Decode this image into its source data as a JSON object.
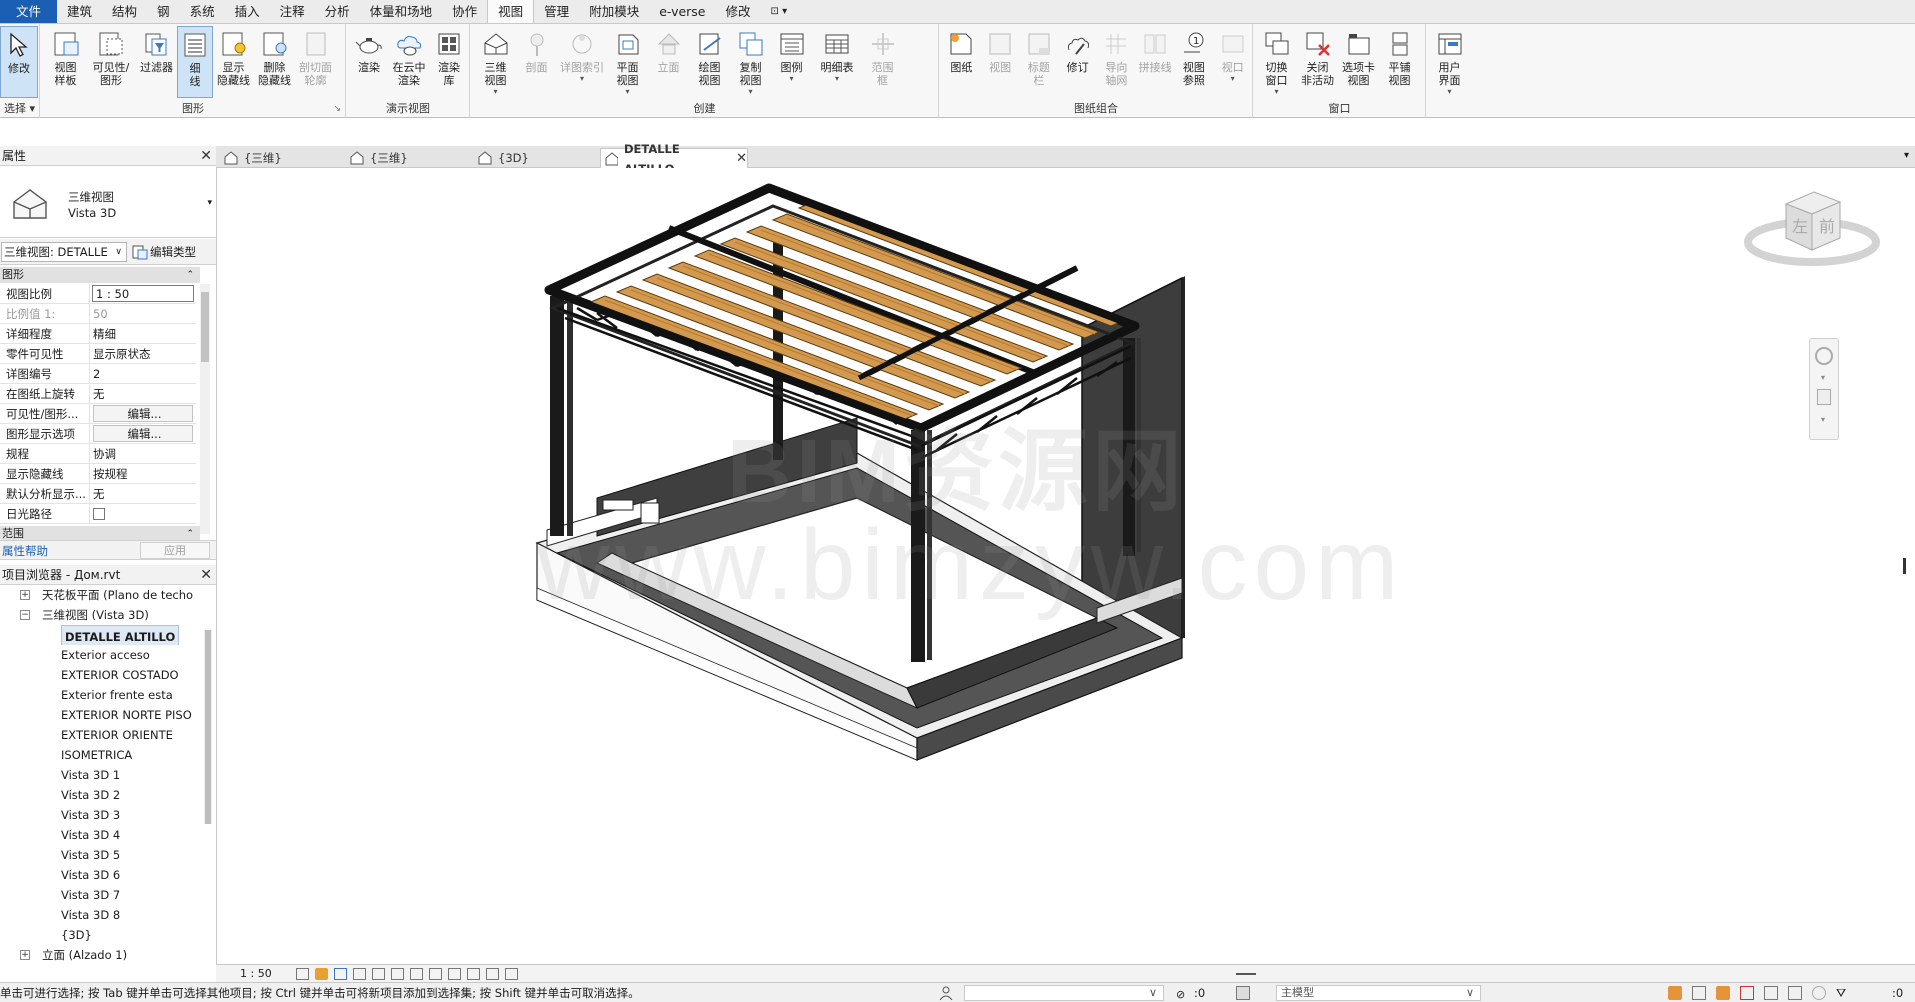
{
  "menu": {
    "tabs": [
      "文件",
      "建筑",
      "结构",
      "钢",
      "系统",
      "插入",
      "注释",
      "分析",
      "体量和场地",
      "协作",
      "视图",
      "管理",
      "附加模块",
      "e-verse",
      "修改",
      "⊡ ▾"
    ],
    "active_tab": "视图"
  },
  "ribbon": {
    "select": {
      "button": "修改",
      "panel": "选择"
    },
    "graphics": {
      "panel": "图形",
      "buttons": [
        "视图\n样板",
        "可见性/\n图形",
        "过滤器",
        "细\n线",
        "显示\n隐藏线",
        "删除\n隐藏线",
        "剖切面\n轮廓"
      ]
    },
    "presentation": {
      "panel": "演示视图",
      "buttons": [
        "渲染",
        "在云中\n渲染",
        "渲染\n库"
      ]
    },
    "create": {
      "panel": "创建",
      "buttons": [
        "三维\n视图",
        "剖面",
        "详图索引",
        "平面\n视图",
        "立面",
        "绘图\n视图",
        "复制\n视图",
        "图例",
        "明细表",
        "范围\n框"
      ]
    },
    "sheet": {
      "panel": "图纸组合",
      "buttons": [
        "图纸",
        "视图",
        "标题\n栏",
        "修订",
        "导向\n轴网",
        "拼接线",
        "视图\n参照",
        "视口"
      ]
    },
    "windows": {
      "panel": "窗口",
      "buttons": [
        "切换\n窗口",
        "关闭\n非活动",
        "选项卡\n视图",
        "平铺\n视图"
      ]
    },
    "ui": {
      "button": "用户\n界面"
    }
  },
  "properties": {
    "title": "属性",
    "type_line1": "三维视图",
    "type_line2": "Vista 3D",
    "filter": "三维视图: DETALLE",
    "edit_type": "编辑类型",
    "section_graphics": "图形",
    "rows": [
      {
        "key": "视图比例",
        "value": "1 : 50"
      },
      {
        "key": "比例值 1:",
        "value": "50"
      },
      {
        "key": "详细程度",
        "value": "精细"
      },
      {
        "key": "零件可见性",
        "value": "显示原状态"
      },
      {
        "key": "详图编号",
        "value": "2"
      },
      {
        "key": "在图纸上旋转",
        "value": "无"
      },
      {
        "key": "可见性/图形...",
        "value": "编辑..."
      },
      {
        "key": "图形显示选项",
        "value": "编辑..."
      },
      {
        "key": "规程",
        "value": "协调"
      },
      {
        "key": "显示隐藏线",
        "value": "按规程"
      },
      {
        "key": "默认分析显示...",
        "value": "无"
      },
      {
        "key": "日光路径",
        "value": ""
      }
    ],
    "section_extents": "范围",
    "help": "属性帮助",
    "apply": "应用"
  },
  "browser": {
    "title": "项目浏览器 - Дом.rvt",
    "items": [
      {
        "label": "天花板平面 (Plano de techo",
        "level": 1,
        "toggle": "+"
      },
      {
        "label": "三维视图 (Vista 3D)",
        "level": 1,
        "toggle": "−"
      },
      {
        "label": "DETALLE ALTILLO",
        "level": 2,
        "toggle": "",
        "selected": true
      },
      {
        "label": "Exterior acceso",
        "level": 2,
        "toggle": ""
      },
      {
        "label": "EXTERIOR COSTADO",
        "level": 2,
        "toggle": ""
      },
      {
        "label": "Exterior frente esta",
        "level": 2,
        "toggle": ""
      },
      {
        "label": "EXTERIOR NORTE PISO",
        "level": 2,
        "toggle": ""
      },
      {
        "label": "EXTERIOR ORIENTE",
        "level": 2,
        "toggle": ""
      },
      {
        "label": "ISOMETRICA",
        "level": 2,
        "toggle": ""
      },
      {
        "label": "Vista 3D 1",
        "level": 2,
        "toggle": ""
      },
      {
        "label": "Vista 3D 2",
        "level": 2,
        "toggle": ""
      },
      {
        "label": "Vista 3D 3",
        "level": 2,
        "toggle": ""
      },
      {
        "label": "Vista 3D 4",
        "level": 2,
        "toggle": ""
      },
      {
        "label": "Vista 3D 5",
        "level": 2,
        "toggle": ""
      },
      {
        "label": "Vista 3D 6",
        "level": 2,
        "toggle": ""
      },
      {
        "label": "Vista 3D 7",
        "level": 2,
        "toggle": ""
      },
      {
        "label": "Vista 3D 8",
        "level": 2,
        "toggle": ""
      },
      {
        "label": "{3D}",
        "level": 2,
        "toggle": ""
      },
      {
        "label": "立面 (Alzado 1)",
        "level": 1,
        "toggle": "+"
      }
    ]
  },
  "view_tabs": [
    {
      "label": "{三维}",
      "active": false
    },
    {
      "label": "{三维}",
      "active": false
    },
    {
      "label": "{3D}",
      "active": false
    },
    {
      "label": "DETALLE ALTILLO",
      "active": true
    }
  ],
  "canvas": {
    "watermark_top": "BIM资源网",
    "watermark_bottom": "www.bimzyw.com",
    "viewcube_left": "左",
    "viewcube_front": "前"
  },
  "view_control": {
    "scale": "1 : 50"
  },
  "status": {
    "message": "单击可进行选择; 按 Tab 键并单击可选择其他项目; 按 Ctrl 键并单击可将新项目添加到选择集; 按 Shift 键并单击可取消选择。",
    "count_left": ":0",
    "model": "主模型",
    "count_right": ":0"
  },
  "colors": {
    "file_tab": "#1a5fb4",
    "timber": "#d39a4f",
    "steel": "#1c1c1c",
    "slab": "#4a4a4a"
  }
}
